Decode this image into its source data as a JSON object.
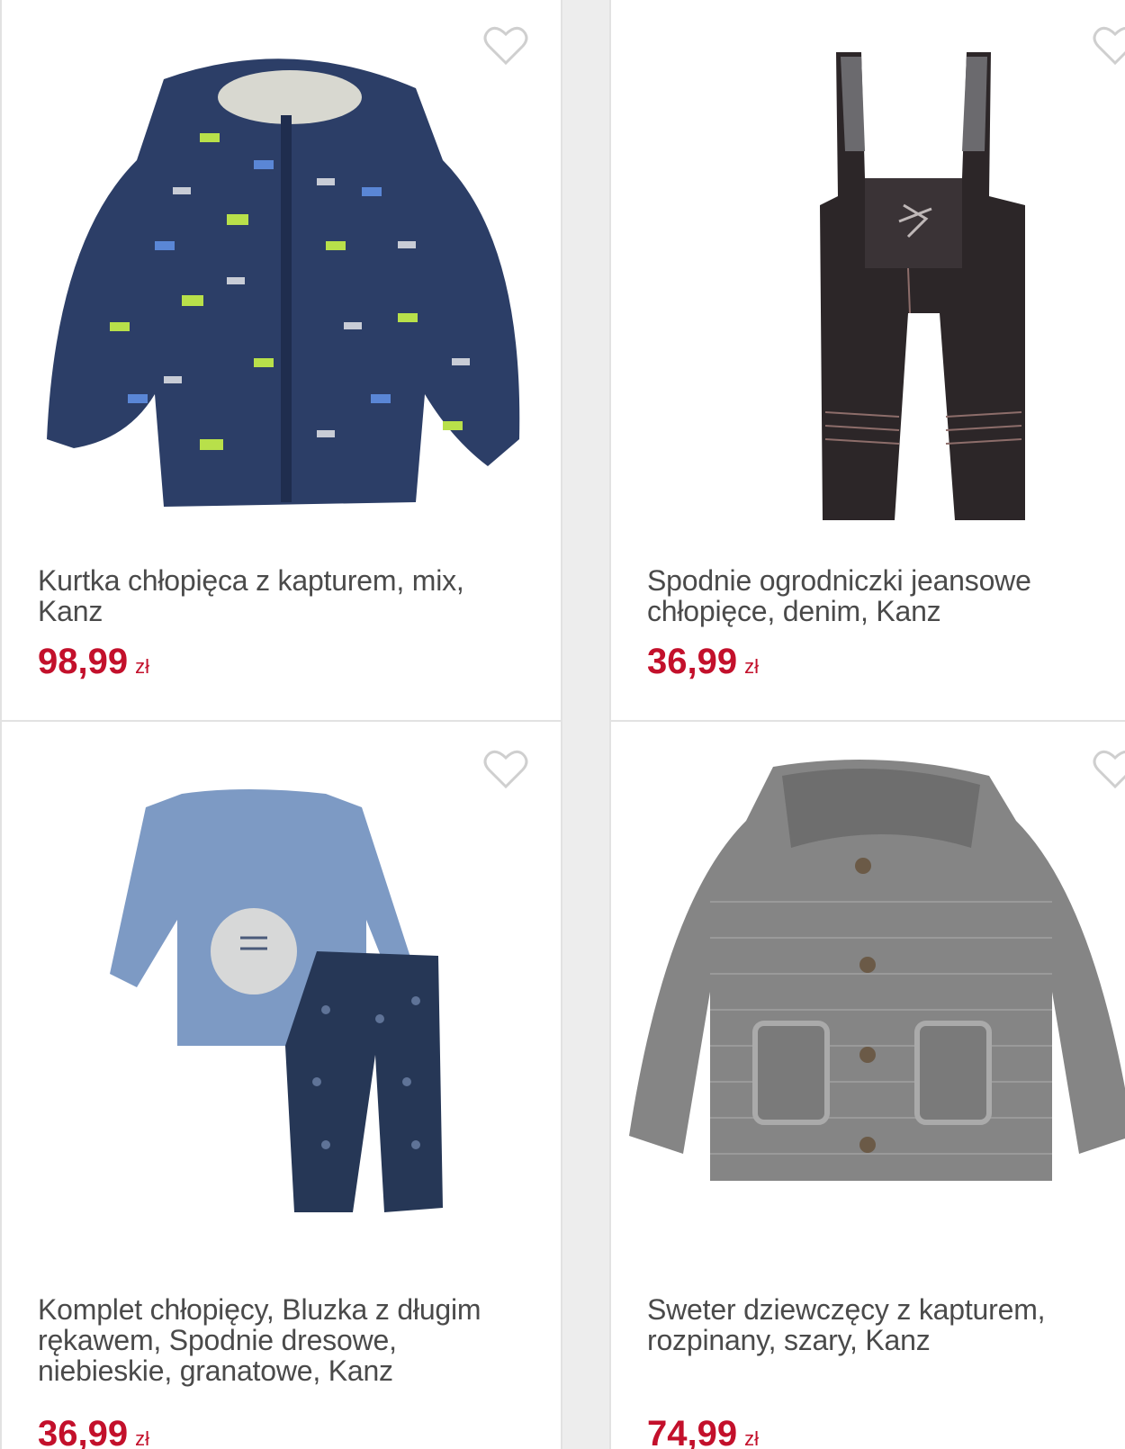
{
  "products": [
    {
      "title": "Kurtka chłopięca z kapturem, mix, Kanz",
      "price": "98,99",
      "currency": "zł",
      "image": "navy-puffer-jacket-with-construction-vehicle-print"
    },
    {
      "title": "Spodnie ogrodniczki jeansowe chłopięce, denim, Kanz",
      "price": "36,99",
      "currency": "zł",
      "image": "dark-denim-overalls-with-airplane-embroidery"
    },
    {
      "title": "Komplet chłopięcy, Bluzka z długim rękawem, Spodnie dresowe, niebieskie, granatowe, Kanz",
      "price": "36,99",
      "currency": "zł",
      "image": "blue-longsleeve-and-navy-pants-set"
    },
    {
      "title": "Sweter dziewczęcy z kapturem, rozpinany, szary, Kanz",
      "price": "74,99",
      "currency": "zł",
      "image": "grey-knitted-hooded-cardigan"
    }
  ],
  "icons": {
    "wishlist": "heart-outline-icon"
  },
  "colors": {
    "price": "#c3102b",
    "title": "#4a4a4a",
    "card_border": "#e2e2e2",
    "background": "#ededed"
  }
}
